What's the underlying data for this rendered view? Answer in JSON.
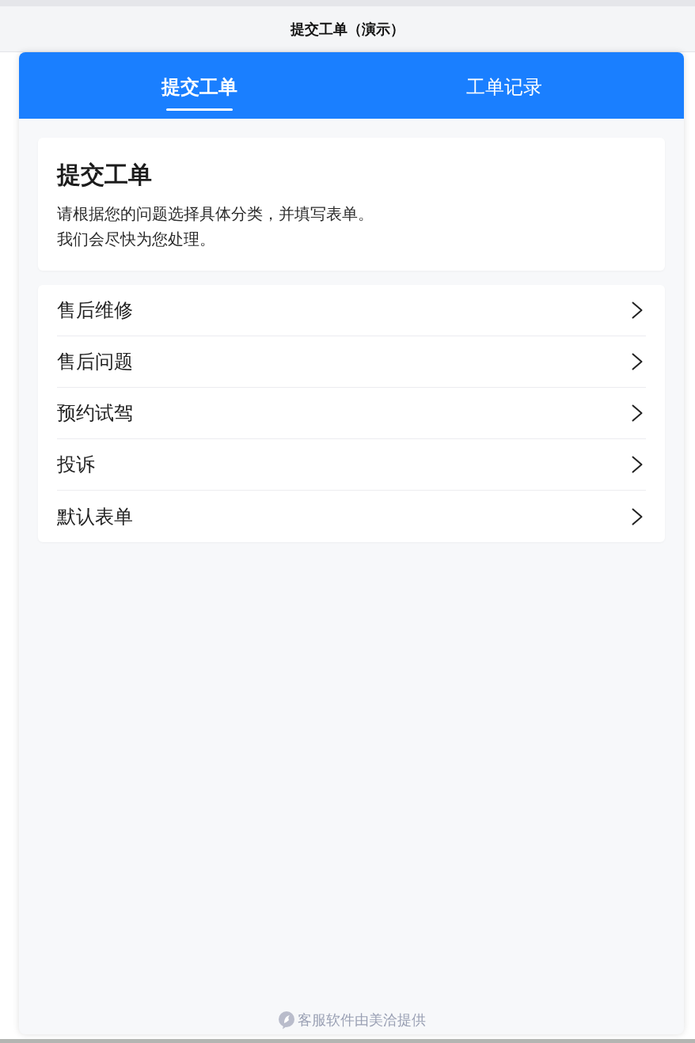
{
  "header": {
    "title": "提交工单（演示）"
  },
  "tabs": [
    {
      "label": "提交工单",
      "selected": true
    },
    {
      "label": "工单记录",
      "selected": false
    }
  ],
  "intro": {
    "title": "提交工单",
    "lines": [
      "请根据您的问题选择具体分类，并填写表单。",
      "我们会尽快为您处理。"
    ]
  },
  "categories": [
    {
      "label": "售后维修"
    },
    {
      "label": "售后问题"
    },
    {
      "label": "预约试驾"
    },
    {
      "label": "投诉"
    },
    {
      "label": "默认表单"
    }
  ],
  "footer": {
    "text": "客服软件由美洽提供"
  }
}
